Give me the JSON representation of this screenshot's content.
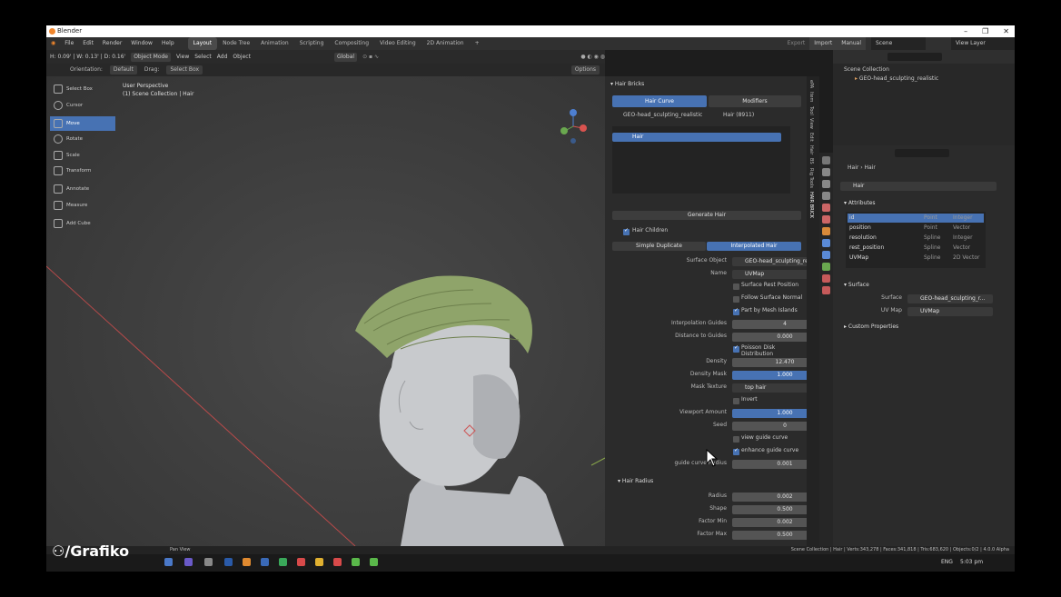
{
  "window": {
    "title": "Blender",
    "controls": [
      "–",
      "❐",
      "✕"
    ]
  },
  "menu": {
    "items": [
      "File",
      "Edit",
      "Render",
      "Window",
      "Help"
    ],
    "workspaces": [
      "Layout",
      "Node Tree",
      "Animation",
      "Scripting",
      "Compositing",
      "Video Editing",
      "2D Animation",
      "+"
    ],
    "right": {
      "export": "Export",
      "import": "Import",
      "manual": "Manual",
      "scene": "Scene",
      "view_layer": "View Layer"
    }
  },
  "toolheader": {
    "transform": "H: 0.09' | W: 0.13' | D: 0.16'",
    "mode": "Object Mode",
    "view": "View",
    "select": "Select",
    "add": "Add",
    "object": "Object",
    "orientation": "Global",
    "options": "Options"
  },
  "optheader": {
    "orientation_label": "Orientation:",
    "orientation_value": "Default",
    "drag_label": "Drag:",
    "drag_value": "Select Box"
  },
  "tools": [
    "Select Box",
    "Cursor",
    "Move",
    "Rotate",
    "Scale",
    "Transform",
    "Annotate",
    "Measure",
    "Add Cube"
  ],
  "viewport": {
    "perspective": "User Perspective",
    "collection": "(1) Scene Collection | Hair"
  },
  "npanel": {
    "panel_title": "Hair Bricks",
    "tab_curve": "Hair Curve",
    "tab_mod": "Modifiers",
    "object": "GEO-head_sculpting_realistic",
    "hair_ref": "Hair (8911)",
    "list_item": "Hair",
    "generate": "Generate Hair",
    "children": "Hair Children",
    "mode_a": "Simple Duplicate",
    "mode_b": "Interpolated Hair",
    "surface_label": "Surface Object",
    "surface_value": "GEO-head_sculpting_realistic",
    "name_label": "Name",
    "name_value": "UVMap",
    "surface_rest": "Surface Rest Position",
    "follow_normal": "Follow Surface Normal",
    "part_islands": "Part by Mesh Islands",
    "interp_label": "Interpolation Guides",
    "interp_value": "4",
    "dist_label": "Distance to Guides",
    "dist_value": "0.000",
    "poisson": "Poisson Disk Distribution",
    "density_label": "Density",
    "density_value": "12.470",
    "dmask_label": "Density Mask",
    "dmask_value": "1.000",
    "mtex_label": "Mask Texture",
    "mtex_value": "top hair",
    "invert": "Invert",
    "vp_label": "Viewport Amount",
    "vp_value": "1.000",
    "seed_label": "Seed",
    "seed_value": "0",
    "view_guide": "view guide curve",
    "enhance_guide": "enhance guide curve",
    "gradius_label": "guide curve Radius",
    "gradius_value": "0.001",
    "radius_section": "Hair Radius",
    "radius_label": "Radius",
    "radius_value": "0.002",
    "shape_label": "Shape",
    "shape_value": "0.500",
    "fmin_label": "Factor Min",
    "fmin_value": "0.002",
    "fmax_label": "Factor Max",
    "fmax_value": "0.500"
  },
  "sidetabs": [
    "ePA",
    "Item",
    "Tool",
    "View",
    "Edit",
    "Hair",
    "BS",
    "Rig Tools",
    "HAIR BRICK"
  ],
  "outliner": {
    "root": "Scene Collection",
    "item": "GEO-head_sculpting_realistic"
  },
  "properties": {
    "breadcrumb_a": "Hair",
    "breadcrumb_b": "Hair",
    "data_name": "Hair",
    "attributes": "Attributes",
    "attr_rows": [
      {
        "name": "id",
        "domain": "Point",
        "type": "Integer"
      },
      {
        "name": "position",
        "domain": "Point",
        "type": "Vector"
      },
      {
        "name": "resolution",
        "domain": "Spline",
        "type": "Integer"
      },
      {
        "name": "rest_position",
        "domain": "Spline",
        "type": "Vector"
      },
      {
        "name": "UVMap",
        "domain": "Spline",
        "type": "2D Vector"
      }
    ],
    "surface": "Surface",
    "surface_label": "Surface",
    "surface_value": "GEO-head_sculpting_r...",
    "uvmap_label": "UV Map",
    "uvmap_value": "UVMap",
    "custom": "Custom Properties"
  },
  "statusbar": {
    "left": "Pan View",
    "right": "Scene Collection | Hair | Verts:343,278 | Faces:341,818 | Tris:683,620 | Objects:0/2 | 4.0.0 Alpha"
  },
  "taskbar": {
    "lang": "ENG",
    "time": "5:03 pm"
  },
  "watermark": "/Grafiko",
  "colors": {
    "accent": "#4772b3",
    "hair": "#8fa46a"
  }
}
